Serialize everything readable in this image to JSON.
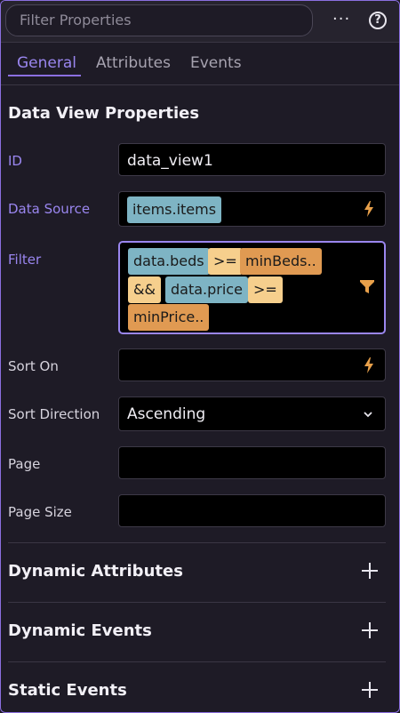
{
  "search": {
    "placeholder": "Filter Properties"
  },
  "header": {
    "more_label": "···",
    "help_label": "?"
  },
  "tabs": [
    {
      "label": "General",
      "active": true
    },
    {
      "label": "Attributes",
      "active": false
    },
    {
      "label": "Events",
      "active": false
    }
  ],
  "section": {
    "title": "Data View Properties"
  },
  "fields": {
    "id": {
      "label": "ID",
      "value": "data_view1"
    },
    "data_source": {
      "label": "Data Source",
      "chip": "items.items"
    },
    "filter": {
      "label": "Filter",
      "tokens": [
        {
          "text": "data.beds",
          "kind": "var"
        },
        {
          "text": ">=",
          "kind": "op"
        },
        {
          "text": "minBeds..",
          "kind": "ref"
        },
        {
          "text": "&&",
          "kind": "op"
        },
        {
          "text": "data.price",
          "kind": "var"
        },
        {
          "text": ">=",
          "kind": "op"
        },
        {
          "text": "minPrice..",
          "kind": "ref"
        }
      ]
    },
    "sort_on": {
      "label": "Sort On",
      "value": ""
    },
    "sort_direction": {
      "label": "Sort Direction",
      "value": "Ascending"
    },
    "page": {
      "label": "Page",
      "value": ""
    },
    "page_size": {
      "label": "Page Size",
      "value": ""
    }
  },
  "collapsibles": [
    {
      "title": "Dynamic Attributes"
    },
    {
      "title": "Dynamic Events"
    },
    {
      "title": "Static Events"
    }
  ],
  "colors": {
    "accent": "#8b6fe0",
    "chip_var": "#7eb4c4",
    "chip_op": "#f6cf8d",
    "chip_ref": "#e09a52",
    "bolt": "#e8a04a"
  }
}
